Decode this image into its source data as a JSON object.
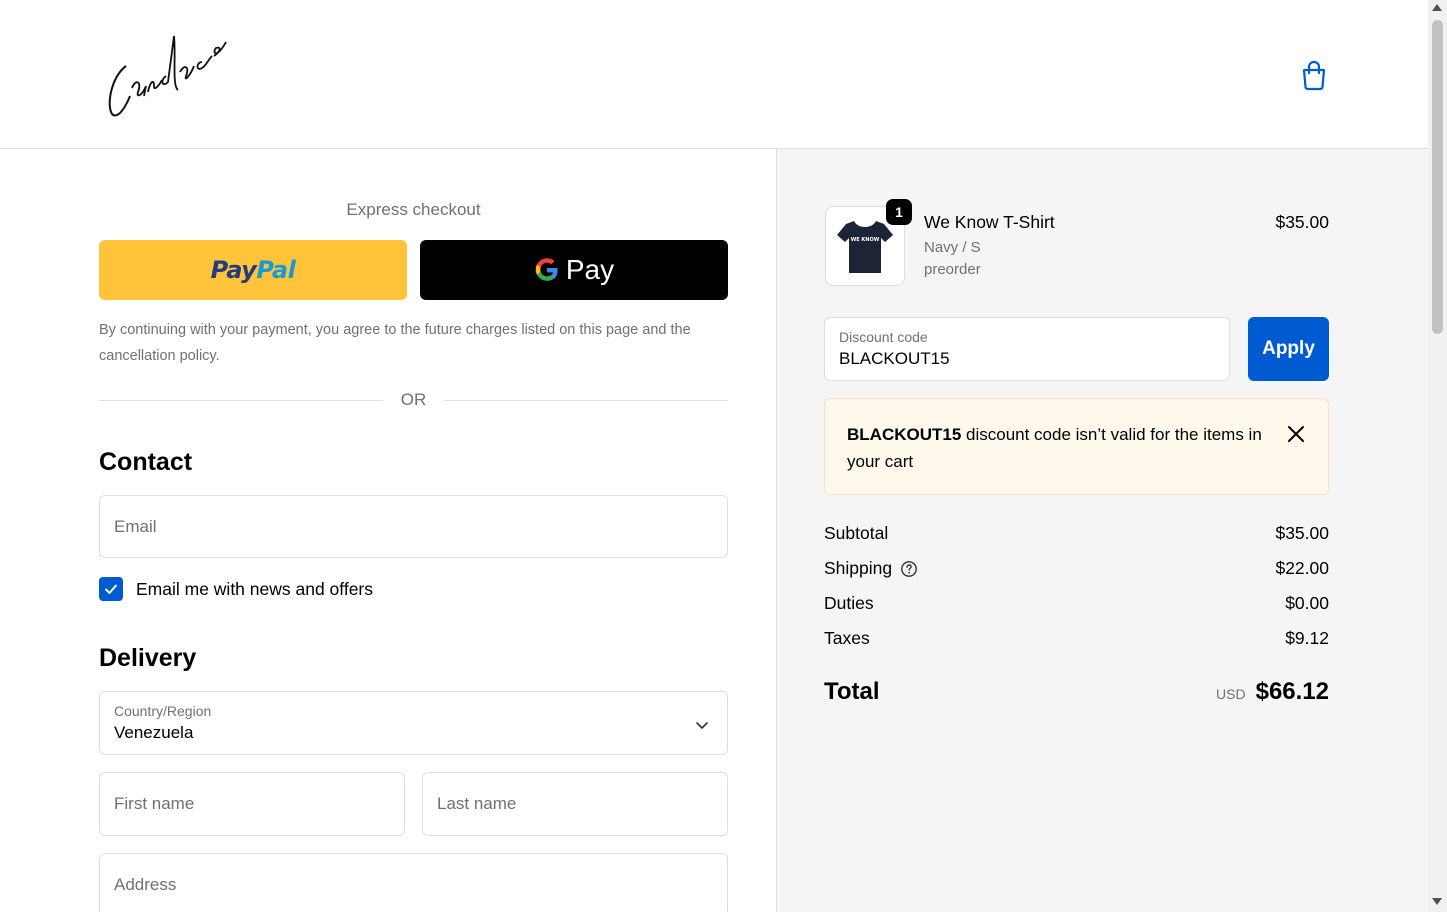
{
  "header": {
    "logo_text": "Candace",
    "cart_icon": "shopping-bag-icon"
  },
  "express": {
    "title": "Express checkout",
    "paypal_label_a": "Pay",
    "paypal_label_b": "Pal",
    "gpay_label": "Pay",
    "legal": "By continuing with your payment, you agree to the future charges listed on this page and the cancellation policy.",
    "or": "OR"
  },
  "contact": {
    "title": "Contact",
    "email_placeholder": "Email",
    "newsletter_label": "Email me with news and offers",
    "newsletter_checked": true
  },
  "delivery": {
    "title": "Delivery",
    "country_label": "Country/Region",
    "country_value": "Venezuela",
    "first_name_placeholder": "First name",
    "last_name_placeholder": "Last name",
    "address_placeholder": "Address"
  },
  "order": {
    "item": {
      "quantity": "1",
      "name": "We Know T-Shirt",
      "variant": "Navy / S",
      "note": "preorder",
      "price": "$35.00",
      "shirt_print": "WE KNOW"
    },
    "discount": {
      "label": "Discount code",
      "value": "BLACKOUT15",
      "apply_label": "Apply"
    },
    "alert": {
      "code": "BLACKOUT15",
      "message": " discount code isn’t valid for the items in your cart"
    },
    "summary": {
      "subtotal_label": "Subtotal",
      "subtotal_value": "$35.00",
      "shipping_label": "Shipping",
      "shipping_value": "$22.00",
      "duties_label": "Duties",
      "duties_value": "$0.00",
      "taxes_label": "Taxes",
      "taxes_value": "$9.12",
      "total_label": "Total",
      "total_currency": "USD",
      "total_value": "$66.12"
    }
  },
  "colors": {
    "accent": "#005bd3",
    "paypal_yellow": "#ffc439",
    "alert_bg": "#fff8ec"
  }
}
